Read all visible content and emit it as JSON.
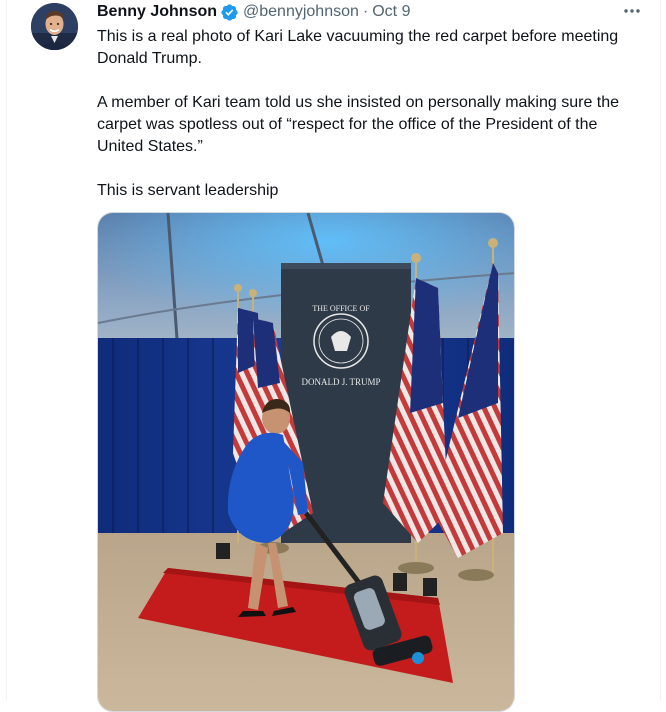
{
  "tweet": {
    "author": {
      "name": "Benny Johnson",
      "handle": "@bennyjohnson",
      "verified_icon": "verified-badge-icon"
    },
    "separator": "·",
    "timestamp": "Oct 9",
    "more_icon": "more-options-icon",
    "paragraphs": [
      "This is a real photo of Kari Lake vacuuming the red carpet before meeting Donald Trump.",
      "A member of Kari team told us she insisted on personally making sure the carpet was spotless out of “respect for the office of the President of the United States.”",
      "This is servant leadership"
    ],
    "photo": {
      "podium_arc_text": "THE OFFICE OF",
      "podium_name": "DONALD J. TRUMP"
    }
  },
  "colors": {
    "text_primary": "#0f1419",
    "text_secondary": "#536471",
    "verified": "#1d9bf0",
    "border": "#cfd9de"
  }
}
